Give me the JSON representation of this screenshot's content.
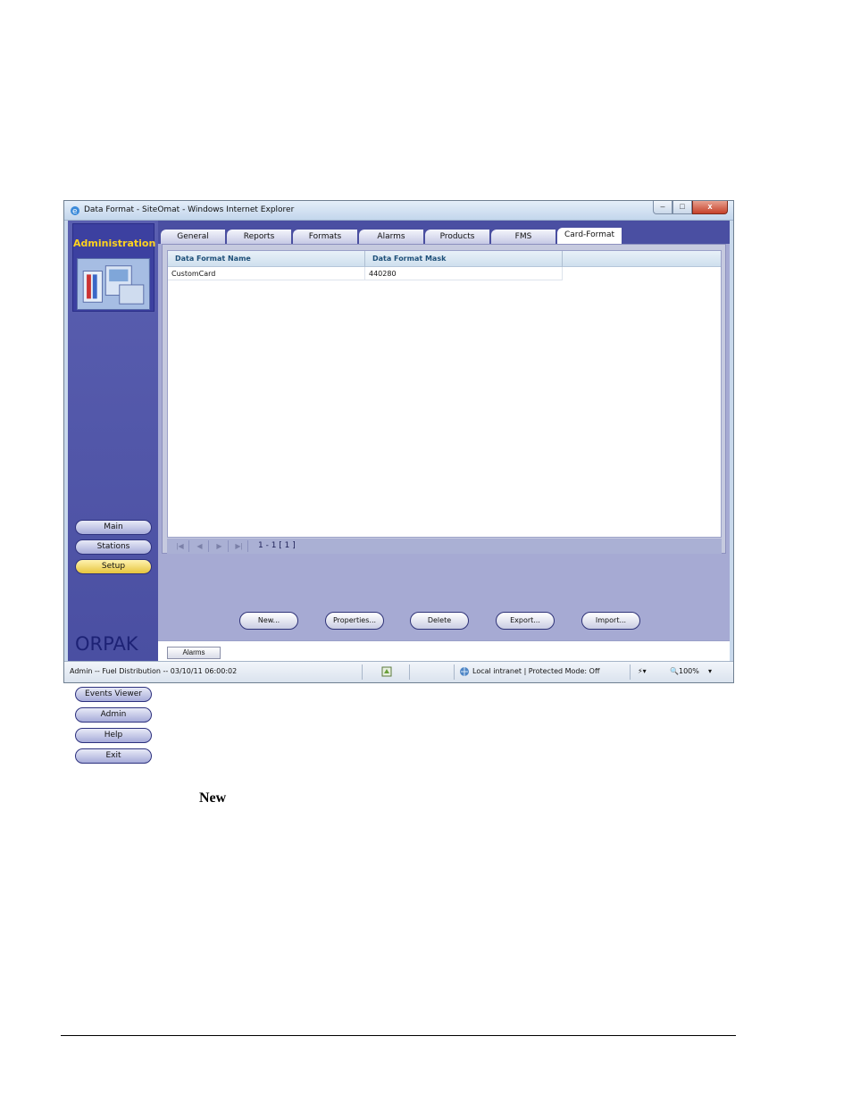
{
  "window": {
    "title": "Data Format - SiteOmat - Windows Internet Explorer",
    "controls": {
      "minimize": "–",
      "maximize": "□",
      "close": "x"
    }
  },
  "sidebar": {
    "header": "Administration",
    "top_buttons": [
      {
        "label": "Main",
        "active": false
      },
      {
        "label": "Stations",
        "active": false
      },
      {
        "label": "Setup",
        "active": true
      }
    ],
    "bottom_buttons": [
      {
        "label": "Events Viewer"
      },
      {
        "label": "Admin"
      },
      {
        "label": "Help"
      },
      {
        "label": "Exit"
      }
    ],
    "logo": "ORPAK"
  },
  "tabs": [
    {
      "label": "General",
      "active": false
    },
    {
      "label": "Reports",
      "active": false
    },
    {
      "label": "Formats",
      "active": false
    },
    {
      "label": "Alarms",
      "active": false
    },
    {
      "label": "Products",
      "active": false
    },
    {
      "label": "FMS",
      "active": false
    },
    {
      "label": "Card-Format",
      "active": true
    }
  ],
  "grid": {
    "columns": [
      "Data Format Name",
      "Data Format Mask"
    ],
    "rows": [
      [
        "CustomCard",
        "440280"
      ]
    ]
  },
  "pager": {
    "first": "|◀",
    "prev": "◀",
    "next": "▶",
    "last": "▶|",
    "info": "1 - 1  [ 1 ]"
  },
  "actions": {
    "new": "New...",
    "properties": "Properties...",
    "delete": "Delete",
    "export": "Export...",
    "import": "Import..."
  },
  "alarm_bar": {
    "button": "Alarms"
  },
  "statusbar": {
    "left": "Admin -- Fuel Distribution -- 03/10/11  06:00:02",
    "zone": "Local intranet | Protected Mode: Off",
    "zoom": "100%"
  },
  "document": {
    "new_word": "New"
  },
  "colors": {
    "sidebar": "#4a4fa2",
    "admin_title": "#ffd21f",
    "active_nav": "#e6c43c",
    "main_bg": "#a6aad3"
  }
}
